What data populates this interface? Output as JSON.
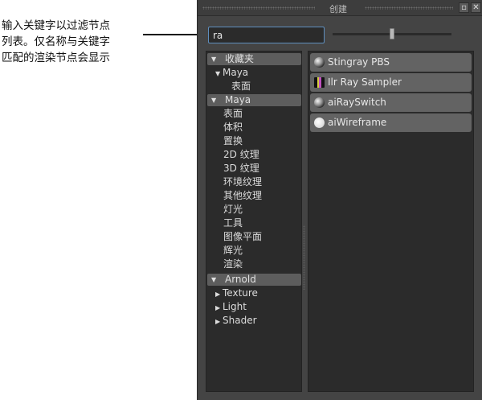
{
  "annotation": {
    "text": "输入关键字以过滤节点\n列表。仅名称与关键字\n匹配的渲染节点会显示"
  },
  "panel": {
    "title": "创建",
    "search": {
      "value": "ra",
      "placeholder": ""
    },
    "slider": {
      "value_fraction": 0.5
    }
  },
  "tree": {
    "favorites": {
      "label": "收藏夹",
      "maya": {
        "label": "Maya",
        "children": [
          "表面"
        ]
      }
    },
    "maya": {
      "label": "Maya",
      "items": [
        "表面",
        "体积",
        "置换",
        "2D 纹理",
        "3D 纹理",
        "环境纹理",
        "其他纹理",
        "灯光",
        "工具",
        "图像平面",
        "辉光",
        "渲染"
      ]
    },
    "arnold": {
      "label": "Arnold",
      "items": [
        "Texture",
        "Light",
        "Shader"
      ]
    }
  },
  "nodes": [
    {
      "label": "Stingray PBS",
      "icon": "sphere-icon"
    },
    {
      "label": "Ilr Ray Sampler",
      "icon": "sampler-icon"
    },
    {
      "label": "aiRaySwitch",
      "icon": "sphere-icon"
    },
    {
      "label": "aiWireframe",
      "icon": "white-sphere-icon"
    }
  ],
  "colors": {
    "panel_bg": "#444444",
    "pane_bg": "#2b2b2b",
    "category_bar": "#5d5d5d",
    "node_bg": "#636363",
    "search_focus": "#5f8fbf"
  }
}
